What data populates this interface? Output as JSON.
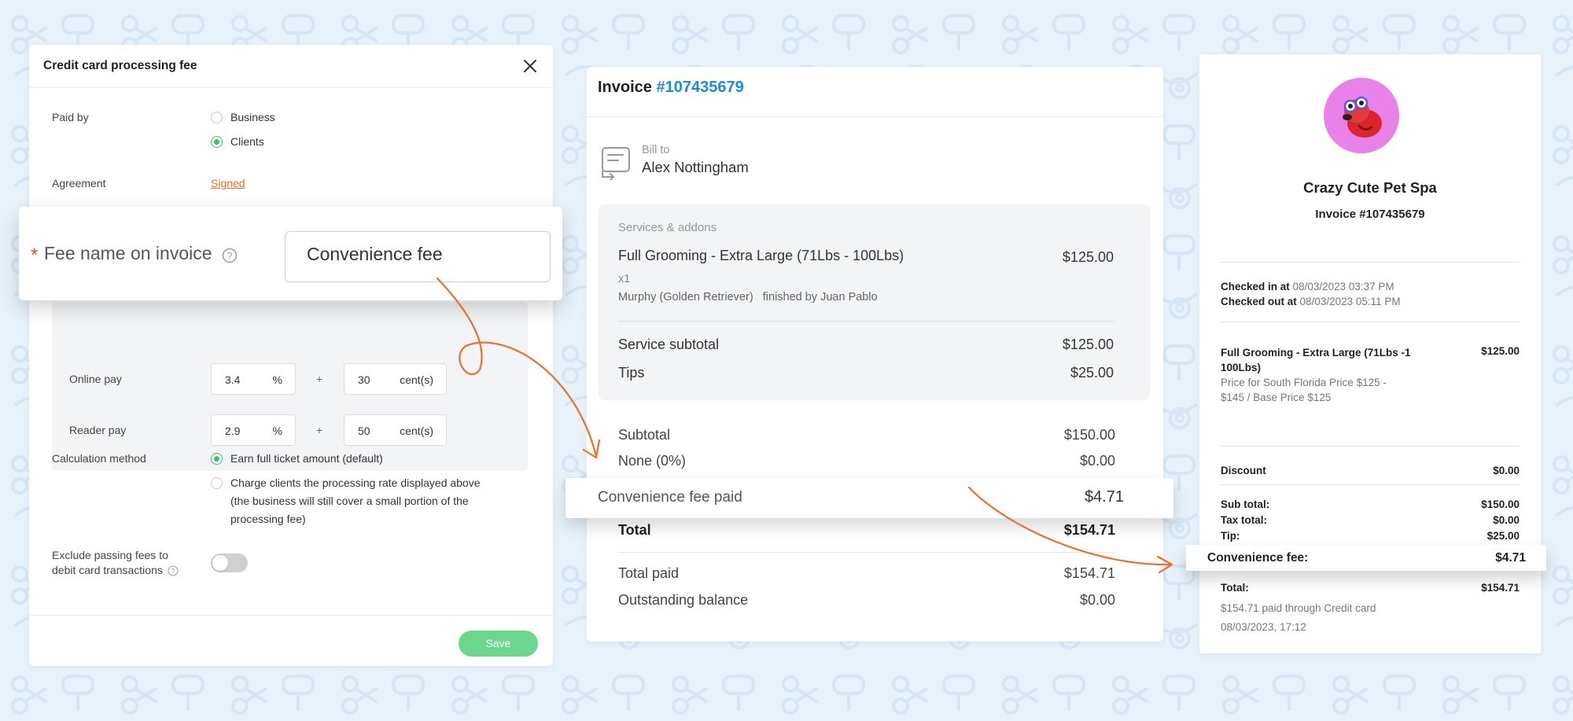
{
  "colors": {
    "background": "#e8f2fb",
    "accent_orange": "#ee6f2d",
    "accent_green": "#3fc26b",
    "link_blue": "#1e88e5"
  },
  "settings_panel": {
    "title": "Credit card processing fee",
    "close_icon": "close-icon",
    "paid_by_label": "Paid by",
    "paid_by_options": [
      {
        "label": "Business",
        "selected": false
      },
      {
        "label": "Clients",
        "selected": true
      }
    ],
    "agreement_label": "Agreement",
    "agreement_value": "Signed",
    "fee_name_label": "Fee name on invoice",
    "fee_name_value": "Convenience fee",
    "online_pay": {
      "label": "Online pay",
      "percent": "3.4",
      "percent_unit": "%",
      "plus": "+",
      "cents": "30",
      "cents_unit": "cent(s)"
    },
    "reader_pay": {
      "label": "Reader pay",
      "percent": "2.9",
      "percent_unit": "%",
      "plus": "+",
      "cents": "50",
      "cents_unit": "cent(s)"
    },
    "calculation_label": "Calculation method",
    "calculation_options": [
      {
        "label": "Earn full ticket amount (default)",
        "selected": true
      },
      {
        "label_lines": [
          "Charge clients the processing rate displayed above",
          "(the business will still cover a small portion of the",
          "processing fee)"
        ],
        "selected": false
      }
    ],
    "exclude_label_lines": [
      "Exclude passing fees to",
      "debit card transactions"
    ],
    "exclude_toggle_on": false,
    "save_label": "Save"
  },
  "invoice_panel": {
    "title_prefix": "Invoice",
    "invoice_number": "#107435679",
    "bill_to_label": "Bill to",
    "bill_to_name": "Alex Nottingham",
    "services_heading": "Services & addons",
    "service": {
      "name": "Full Grooming - Extra Large (71Lbs - 100Lbs)",
      "price": "$125.00",
      "qty": "x1",
      "pet": "Murphy (Golden Retriever)",
      "staff": "finished by Juan Pablo"
    },
    "service_subtotal": {
      "label": "Service subtotal",
      "value": "$125.00"
    },
    "tips": {
      "label": "Tips",
      "value": "$25.00"
    },
    "subtotal": {
      "label": "Subtotal",
      "value": "$150.00"
    },
    "discount": {
      "label": "None (0%)",
      "value": "$0.00"
    },
    "convenience_fee": {
      "label": "Convenience fee paid",
      "value": "$4.71"
    },
    "total": {
      "label": "Total",
      "value": "$154.71"
    },
    "total_paid": {
      "label": "Total paid",
      "value": "$154.71"
    },
    "outstanding": {
      "label": "Outstanding balance",
      "value": "$0.00"
    }
  },
  "receipt_panel": {
    "business_name": "Crazy Cute Pet Spa",
    "invoice_line": "Invoice #107435679",
    "checked_in_label": "Checked in at",
    "checked_in_value": "08/03/2023 03:37 PM",
    "checked_out_label": "Checked out at",
    "checked_out_value": "08/03/2023 05:11 PM",
    "service_name_lines": [
      "Full Grooming - Extra Large (71Lbs -1",
      "100Lbs)"
    ],
    "service_price": "$125.00",
    "service_desc_lines": [
      "Price for South Florida Price $125 -",
      "$145 / Base Price $125"
    ],
    "discount": {
      "label": "Discount",
      "value": "$0.00"
    },
    "sub_total": {
      "label": "Sub total:",
      "value": "$150.00"
    },
    "tax_total": {
      "label": "Tax total:",
      "value": "$0.00"
    },
    "tip": {
      "label": "Tip:",
      "value": "$25.00"
    },
    "convenience_fee": {
      "label": "Convenience fee:",
      "value": "$4.71"
    },
    "total": {
      "label": "Total:",
      "value": "$154.71"
    },
    "paid_through": "$154.71 paid through Credit card",
    "paid_date": "08/03/2023, 17:12"
  }
}
